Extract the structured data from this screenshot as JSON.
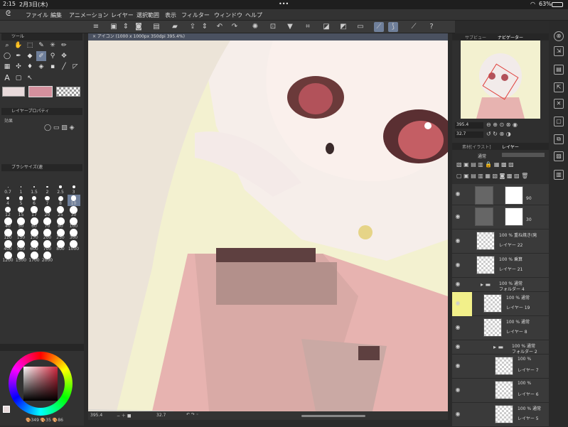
{
  "status": {
    "time": "2:15",
    "date": "2月3日(木)",
    "dots": "•••",
    "battery": "63%"
  },
  "menu": [
    "ファイル",
    "編集",
    "アニメーション",
    "レイヤー",
    "選択範囲",
    "表示",
    "フィルター",
    "ウィンドウ",
    "ヘルプ"
  ],
  "panels": {
    "tool": "ツール",
    "layer_property": "レイヤープロパティ",
    "effect": "効果",
    "brush_size": "ブラシサイズ(速",
    "sub_view": "サブビュー",
    "navigator": "ナビゲーター",
    "layer_tab_a": "素材[イラスト]",
    "layer_tab_b": "レイヤー"
  },
  "document_tab": "× アイコン (1000 x 1000px 350dpi 395.4%)",
  "brush_sizes": [
    "0.7",
    "1",
    "1.5",
    "2",
    "2.5",
    "3",
    "4",
    "5",
    "6",
    "7",
    "8",
    "10",
    "12",
    "15",
    "17",
    "20",
    "25",
    "30",
    "40",
    "50",
    "60",
    "70",
    "80",
    "100",
    "120",
    "150",
    "170",
    "200",
    "250",
    "300",
    "400",
    "500",
    "600",
    "700",
    "800",
    "1000",
    "1200",
    "1500",
    "1700",
    "2000"
  ],
  "navigator": {
    "zoom": "395.4",
    "angle": "32.7"
  },
  "layer_blend": "通常",
  "layers": [
    {
      "pct": "",
      "name": "90",
      "type": "folder-mask"
    },
    {
      "pct": "",
      "name": "30",
      "type": "folder-mask"
    },
    {
      "pct": "100 % 重ね焼き(発",
      "name": "レイヤー 22",
      "type": "raster"
    },
    {
      "pct": "100 % 乗算",
      "name": "レイヤー 21",
      "type": "raster"
    },
    {
      "pct": "100 % 通常",
      "name": "フォルダー 4",
      "type": "folder"
    },
    {
      "pct": "100 % 通常",
      "name": "レイヤー 19",
      "type": "raster"
    },
    {
      "pct": "100 % 通常",
      "name": "レイヤー 8",
      "type": "raster"
    },
    {
      "pct": "100 % 通常",
      "name": "フォルダー 2",
      "type": "folder"
    },
    {
      "pct": "100 %",
      "name": "レイヤー 7",
      "type": "raster"
    },
    {
      "pct": "100 %",
      "name": "レイヤー 6",
      "type": "raster"
    },
    {
      "pct": "100 % 通常",
      "name": "レイヤー 5",
      "type": "raster"
    }
  ],
  "bottom": {
    "zoom": "395.4",
    "angle": "32.7"
  },
  "color_info": "🎨349 🎨35 🎨86"
}
